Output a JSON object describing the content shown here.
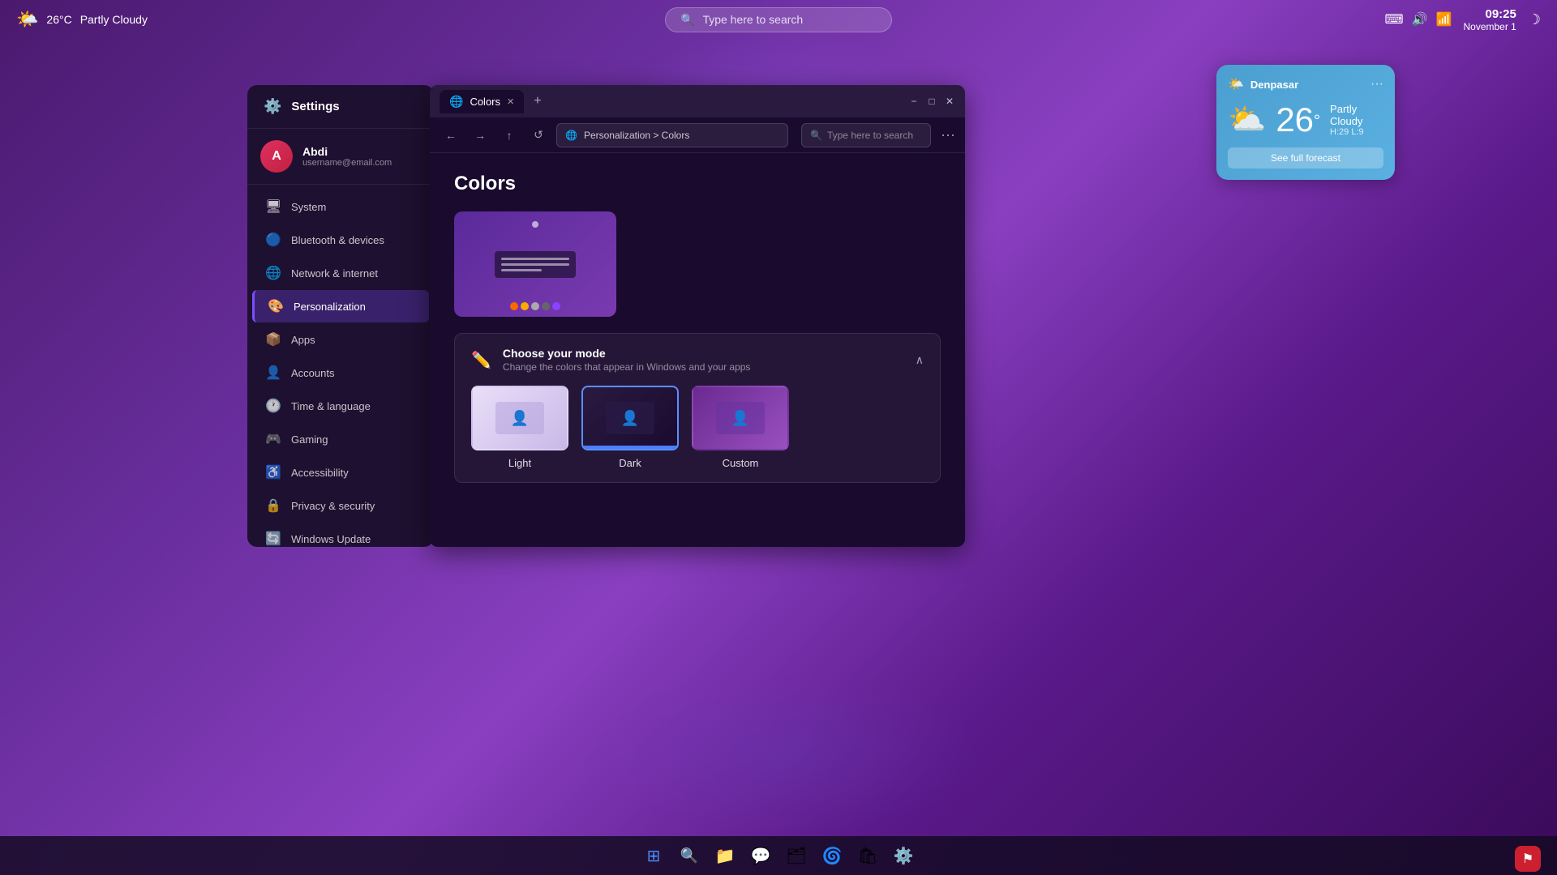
{
  "topbar": {
    "weather_icon": "🌤️",
    "temperature": "26°C",
    "weather_condition": "Partly Cloudy",
    "search_placeholder": "Type here to search",
    "system_tray": {
      "keyboard_icon": "⌨",
      "speaker_icon": "🔊",
      "wifi_icon": "📶",
      "time": "09:25",
      "date": "November 1",
      "sleep_icon": "☽"
    }
  },
  "weather_widget": {
    "location": "Denpasar",
    "more_label": "···",
    "temperature": "26",
    "temp_unit": "°",
    "condition": "Partly Cloudy",
    "hl": "H:29 L:9",
    "forecast_btn": "See full forecast"
  },
  "settings": {
    "title": "Settings",
    "user": {
      "name": "Abdi",
      "email": "username@email.com",
      "initial": "A"
    },
    "nav_items": [
      {
        "id": "system",
        "icon": "🖥",
        "label": "System"
      },
      {
        "id": "bluetooth",
        "icon": "🔵",
        "label": "Bluetooth & devices"
      },
      {
        "id": "network",
        "icon": "🌐",
        "label": "Network & internet"
      },
      {
        "id": "personalization",
        "icon": "🎨",
        "label": "Personalization",
        "active": true
      },
      {
        "id": "apps",
        "icon": "📦",
        "label": "Apps"
      },
      {
        "id": "accounts",
        "icon": "👤",
        "label": "Accounts"
      },
      {
        "id": "time",
        "icon": "🕐",
        "label": "Time & language"
      },
      {
        "id": "gaming",
        "icon": "🎮",
        "label": "Gaming"
      },
      {
        "id": "accessibility",
        "icon": "♿",
        "label": "Accessibility"
      },
      {
        "id": "privacy",
        "icon": "🔒",
        "label": "Privacy & security"
      },
      {
        "id": "update",
        "icon": "🔄",
        "label": "Windows Update"
      }
    ]
  },
  "browser": {
    "tab_label": "Colors",
    "tab_favicon": "🌐",
    "new_tab_label": "+",
    "win_min": "−",
    "win_max": "□",
    "win_close": "✕",
    "nav": {
      "back": "←",
      "forward": "→",
      "up": "↑",
      "refresh": "↺"
    },
    "breadcrumb": "Personalization  >  Colors",
    "search_placeholder": "Type here to search",
    "more_btn": "···"
  },
  "colors_page": {
    "title": "Colors",
    "preview_swatches": [
      "#ff6600",
      "#ffaa00",
      "#aaaaaa",
      "#666666",
      "#8844ff"
    ],
    "mode_section": {
      "icon": "✏️",
      "title": "Choose your mode",
      "description": "Change the colors that appear in Windows and your apps",
      "chevron": "∧",
      "options": [
        {
          "id": "light",
          "label": "Light"
        },
        {
          "id": "dark",
          "label": "Dark",
          "selected": true
        },
        {
          "id": "custom",
          "label": "Custom"
        }
      ]
    }
  },
  "taskbar": {
    "items": [
      {
        "id": "start",
        "icon": "⊞",
        "label": "Start"
      },
      {
        "id": "search",
        "icon": "🔍",
        "label": "Search"
      },
      {
        "id": "files",
        "icon": "📁",
        "label": "File Explorer"
      },
      {
        "id": "teams",
        "icon": "💬",
        "label": "Teams"
      },
      {
        "id": "folders",
        "icon": "🗂",
        "label": "Folders"
      },
      {
        "id": "edge",
        "icon": "🌀",
        "label": "Edge"
      },
      {
        "id": "store",
        "icon": "🛍",
        "label": "Store"
      },
      {
        "id": "settings2",
        "icon": "⚙️",
        "label": "Settings"
      }
    ]
  }
}
